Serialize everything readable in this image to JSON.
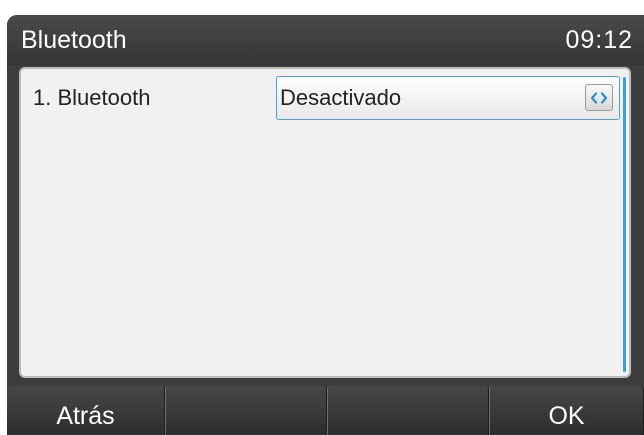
{
  "header": {
    "title": "Bluetooth",
    "time": "09:12"
  },
  "settings": {
    "rows": [
      {
        "label": "1. Bluetooth",
        "value": "Desactivado",
        "toggle_icon": "left-right-arrows-icon"
      }
    ]
  },
  "softkeys": {
    "key1": "Atrás",
    "key2": "",
    "key3": "",
    "key4": "OK"
  },
  "colors": {
    "accent": "#3f9fd0",
    "screen_bg": "#3d3d3d",
    "panel_bg": "#f1f1f1"
  }
}
